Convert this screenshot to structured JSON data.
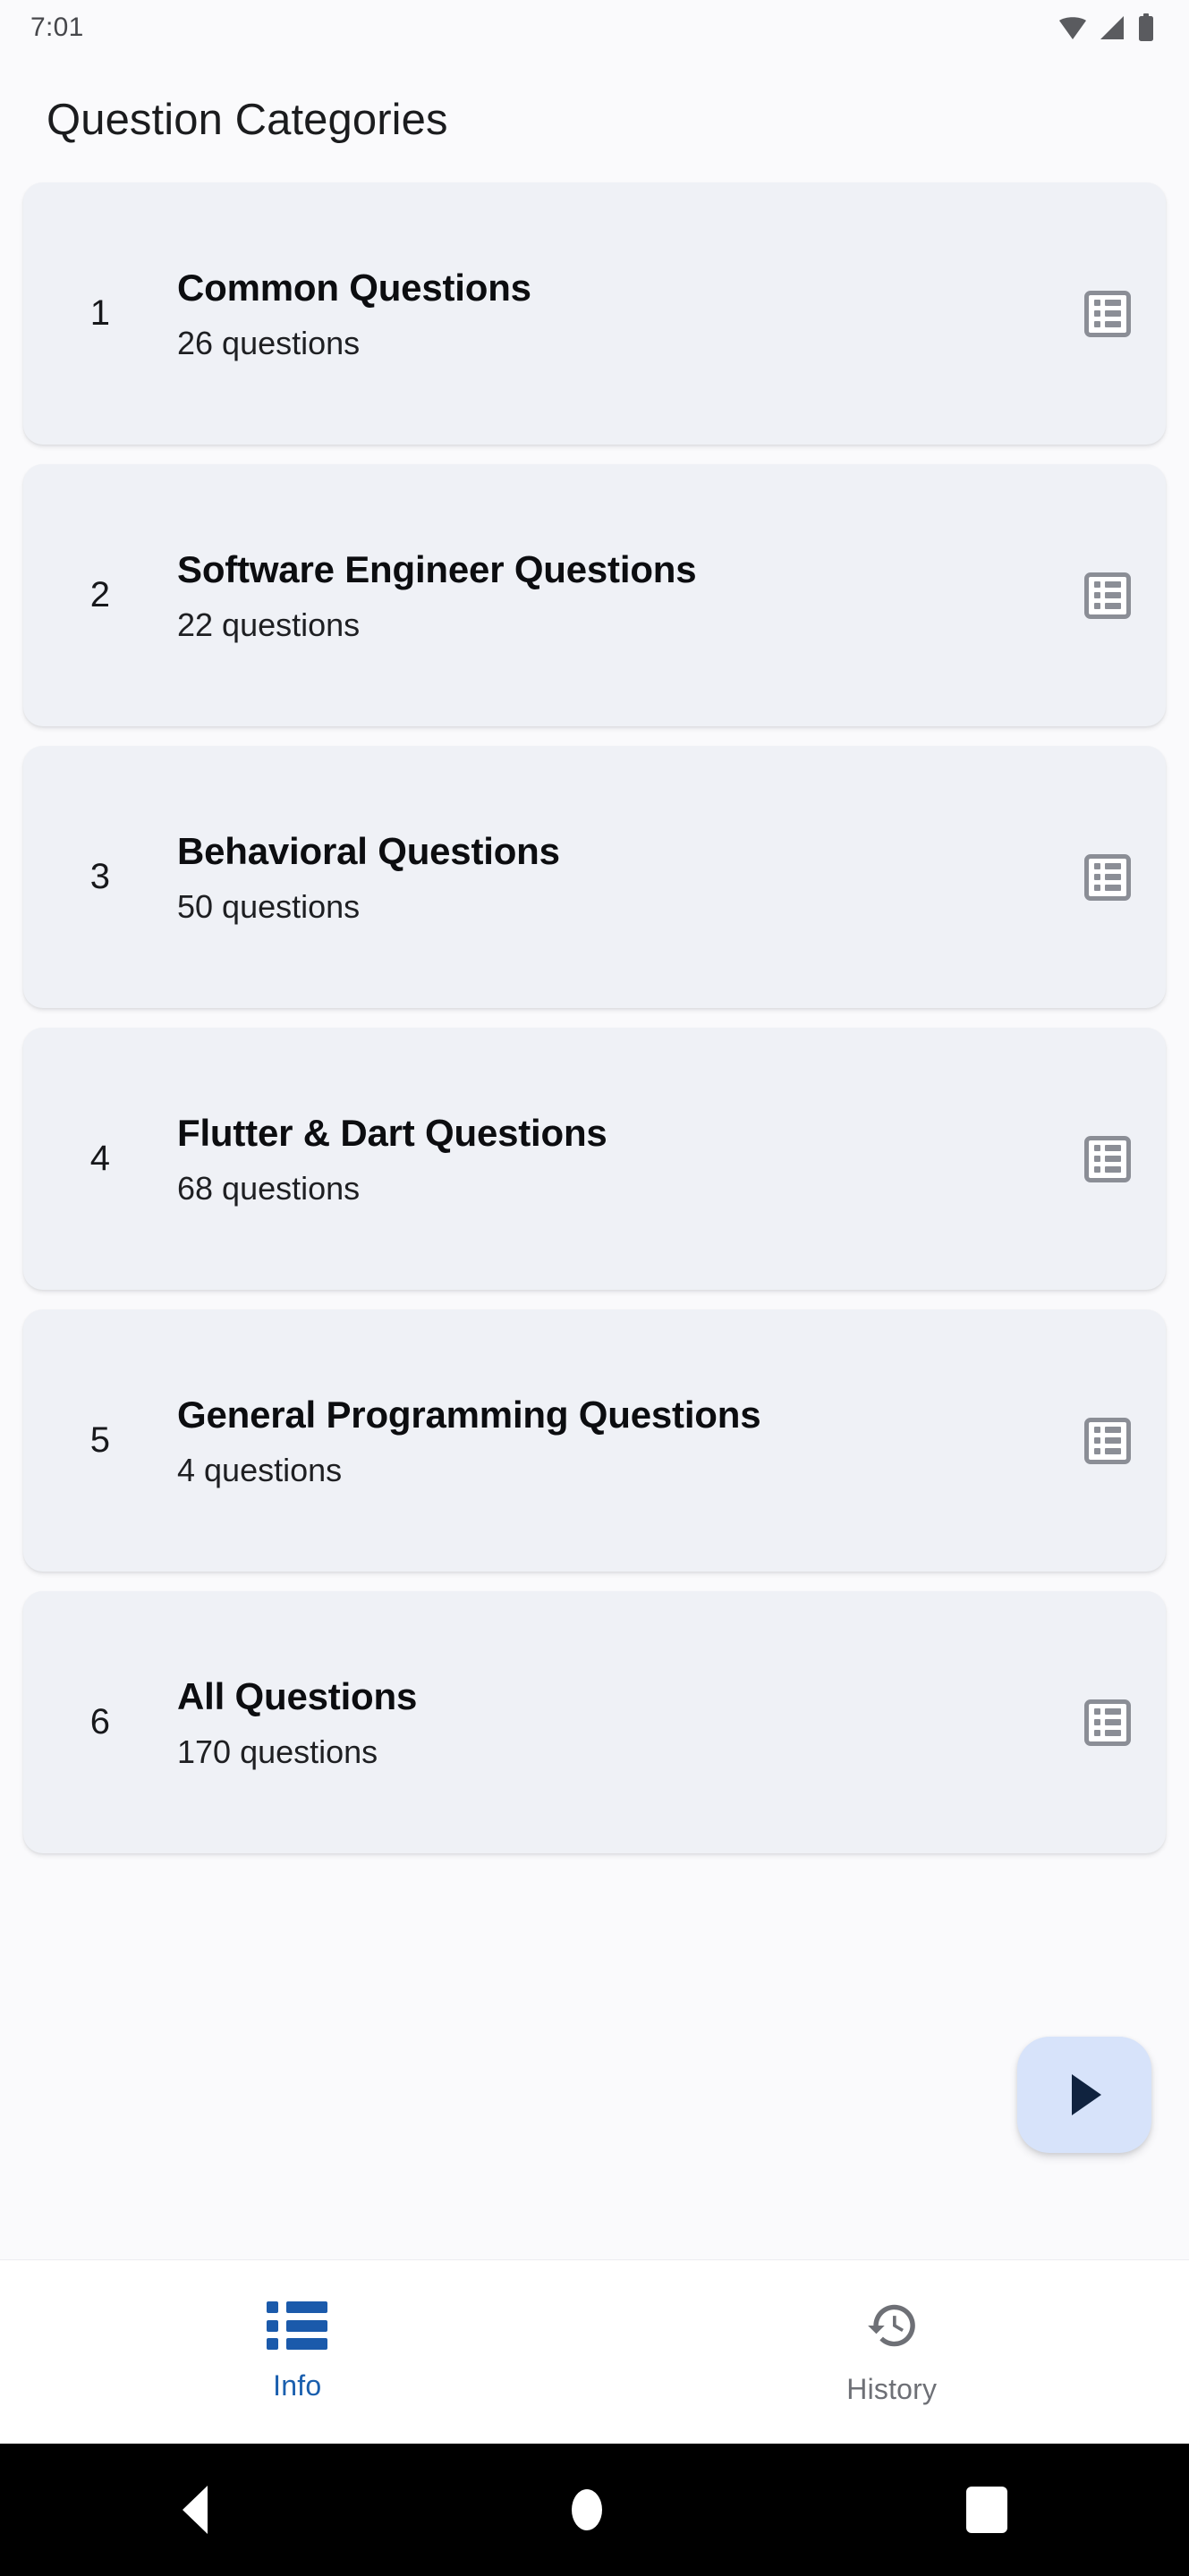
{
  "status_bar": {
    "time": "7:01",
    "icons": [
      "wifi-icon",
      "cellular-signal-icon",
      "battery-icon"
    ]
  },
  "header": {
    "title": "Question Categories"
  },
  "categories": [
    {
      "number": "1",
      "title": "Common Questions",
      "subtitle": "26 questions",
      "trailing_icon": "list-alt-icon"
    },
    {
      "number": "2",
      "title": "Software Engineer Questions",
      "subtitle": "22 questions",
      "trailing_icon": "list-alt-icon"
    },
    {
      "number": "3",
      "title": "Behavioral Questions",
      "subtitle": "50 questions",
      "trailing_icon": "list-alt-icon"
    },
    {
      "number": "4",
      "title": "Flutter & Dart Questions",
      "subtitle": "68 questions",
      "trailing_icon": "list-alt-icon"
    },
    {
      "number": "5",
      "title": "General Programming Questions",
      "subtitle": "4 questions",
      "trailing_icon": "list-alt-icon"
    },
    {
      "number": "6",
      "title": "All Questions",
      "subtitle": "170 questions",
      "trailing_icon": "list-alt-icon"
    }
  ],
  "fab": {
    "icon": "play-icon",
    "background": "#D7E3FA",
    "icon_color": "#10233F"
  },
  "bottom_nav": {
    "items": [
      {
        "label": "Info",
        "icon": "list-icon",
        "active": true
      },
      {
        "label": "History",
        "icon": "history-icon",
        "active": false
      }
    ],
    "active_color": "#1A5FAE",
    "inactive_color": "#6E7076"
  },
  "android_nav": {
    "buttons": [
      "back-icon",
      "home-icon",
      "recents-icon"
    ]
  },
  "colors": {
    "page_background": "#FAFAFC",
    "card_background": "#EFF1F6",
    "card_title": "#0C0D10",
    "trailing_icon": "#8B8E96"
  }
}
